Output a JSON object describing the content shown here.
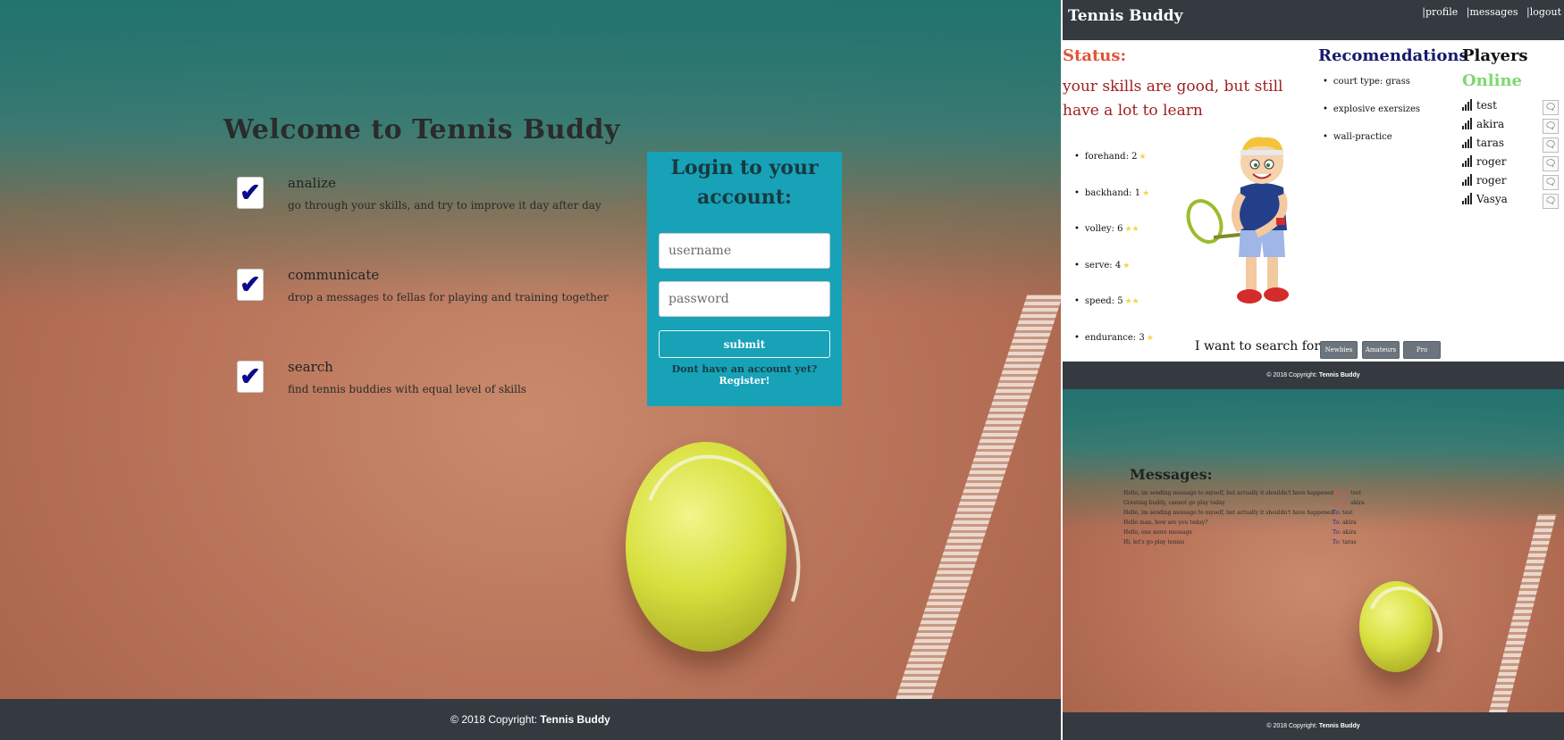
{
  "login_page": {
    "welcome_prefix": "Welcome to",
    "welcome_brand": "Tennis Buddy",
    "features": [
      {
        "title": "analize",
        "description": "go through your skills, and try to improve it day after day"
      },
      {
        "title": "communicate",
        "description": "drop a messages to fellas for playing and training together"
      },
      {
        "title": "search",
        "description": "find tennis buddies with equal level of skills"
      }
    ],
    "login": {
      "title_line1": "Login to your",
      "title_line2": "account:",
      "username_placeholder": "username",
      "password_placeholder": "password",
      "submit_label": "submit",
      "register_prompt": "Dont have an account yet?",
      "register_link": "Register!"
    },
    "footer": {
      "copyright": "© 2018 Copyright:",
      "brand": "Tennis Buddy"
    }
  },
  "profile_page": {
    "navbar": {
      "brand": "Tennis Buddy",
      "links": [
        "|profile",
        "|messages",
        "|logout"
      ]
    },
    "status_heading": "Status:",
    "status_text": "your skills are good, but still have a lot to learn",
    "skills": [
      {
        "label": "forehand: 2",
        "stars": "★"
      },
      {
        "label": "backhand: 1",
        "stars": "★"
      },
      {
        "label": "volley: 6",
        "stars": "★★"
      },
      {
        "label": "serve: 4",
        "stars": "★"
      },
      {
        "label": "speed: 5",
        "stars": "★★"
      },
      {
        "label": "endurance: 3",
        "stars": "★"
      }
    ],
    "recommendations_heading": "Recomendations",
    "recommendations": [
      "court type: grass",
      "explosive exersizes",
      "wall-practice"
    ],
    "players_heading": "Players",
    "online_heading": "Online",
    "players": [
      "test",
      "akira",
      "taras",
      "roger",
      "roger",
      "Vasya"
    ],
    "search_label": "I want to search for:",
    "search_buttons": [
      "Newbies",
      "Amateurs",
      "Pro"
    ],
    "footer": {
      "copyright": "© 2018 Copyright:",
      "brand": "Tennis Buddy"
    }
  },
  "messages_page": {
    "heading": "Messages:",
    "messages": [
      {
        "text": "Hello, im sending message to myself, but actually it shouldn't have happened",
        "direction": "From:",
        "user": "test"
      },
      {
        "text": "Greeting buddy, cannot go play today",
        "direction": "From:",
        "user": "akira"
      },
      {
        "text": "Hello, im sending message to myself, but actually it shouldn't have happened",
        "direction": "To:",
        "user": "test"
      },
      {
        "text": "Hello man, how are you today?",
        "direction": "To:",
        "user": "akira"
      },
      {
        "text": "Hello, one more message",
        "direction": "To:",
        "user": "akira"
      },
      {
        "text": "Hi, let's go play tennis",
        "direction": "To:",
        "user": "taras"
      }
    ],
    "footer": {
      "copyright": "© 2018 Copyright:",
      "brand": "Tennis Buddy"
    }
  },
  "colors": {
    "navbar": "#343a40",
    "login_box": "#17a2b8",
    "status": "#e0553a",
    "online": "#7fd86d",
    "recommendations": "#151a6b"
  }
}
